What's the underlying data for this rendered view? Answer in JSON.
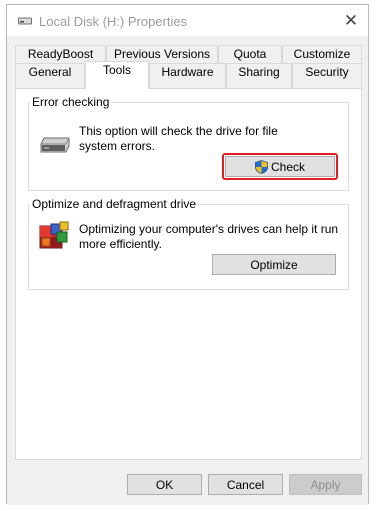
{
  "window": {
    "title": "Local Disk (H:) Properties",
    "close_glyph": "✕"
  },
  "tabs": {
    "row1": [
      "ReadyBoost",
      "Previous Versions",
      "Quota",
      "Customize"
    ],
    "row2": [
      "General",
      "Tools",
      "Hardware",
      "Sharing",
      "Security"
    ],
    "selected": "Tools"
  },
  "error_checking": {
    "heading": "Error checking",
    "description_line1": "This option will check the drive for file",
    "description_line2": "system errors.",
    "check_label": "Check",
    "icon": "drive-icon",
    "button_icon": "uac-shield-icon"
  },
  "optimize": {
    "heading": "Optimize and defragment drive",
    "description_line1": "Optimizing your computer's drives can help it run",
    "description_line2": "more efficiently.",
    "optimize_label": "Optimize",
    "icon": "defrag-icon"
  },
  "footer": {
    "ok_label": "OK",
    "cancel_label": "Cancel",
    "apply_label": "Apply"
  },
  "colors": {
    "highlight": "#e02020",
    "shield_blue": "#1f6fd0",
    "shield_yellow": "#f2c21a"
  }
}
